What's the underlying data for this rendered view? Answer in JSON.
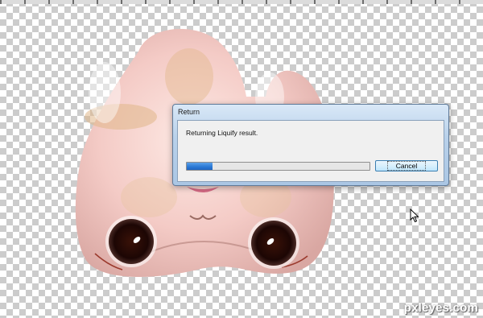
{
  "dialog": {
    "title": "Return",
    "message": "Returning Liquify result.",
    "progress_fraction": 0.14,
    "cancel_label": "Cancel"
  },
  "watermark": "pxleyes.com",
  "colors": {
    "progress_fill": "#2c7ad6",
    "dialog_title_bar": "#b9d1ea",
    "skin": "#f3c9c4"
  }
}
